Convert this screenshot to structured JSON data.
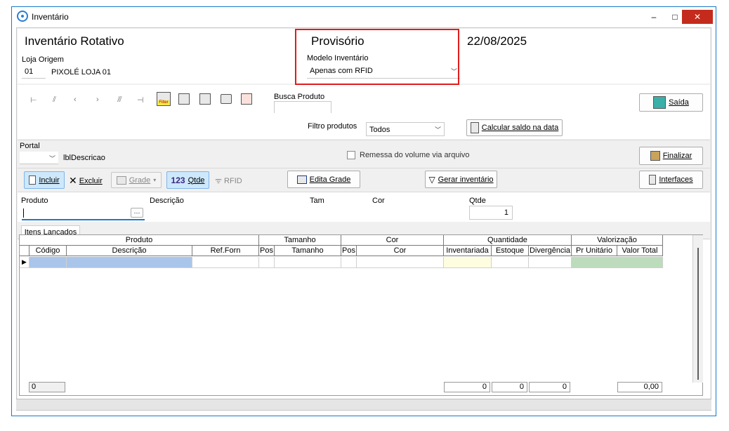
{
  "window": {
    "title": "Inventário",
    "minimize": "–",
    "maximize": "□",
    "close": "✕"
  },
  "header": {
    "title": "Inventário Rotativo",
    "status": "Provisório",
    "date": "22/08/2025",
    "loja_origem_label": "Loja Origem",
    "loja_code": "01",
    "loja_name": "PIXOLÉ LOJA 01",
    "modelo_label": "Modelo Inventário",
    "modelo_value": "Apenas com RFID"
  },
  "toolbar": {
    "busca_label": "Busca Produto",
    "busca_value": "",
    "saida_label": "Saída",
    "filter_icon_text": "Filter"
  },
  "filters": {
    "filtro_label": "Filtro produtos",
    "filtro_value": "Todos",
    "calcular_label": "Calcular saldo na data"
  },
  "portal": {
    "label": "Portal",
    "value": "",
    "descricao": "lblDescricao",
    "remessa_label": "Remessa do volume via arquivo",
    "finalizar_label": "Finalizar"
  },
  "actions": {
    "incluir": "Incluir",
    "excluir": "Excluir",
    "grade": "Grade",
    "qtde": "Qtde",
    "qtde_prefix": "123",
    "rfid": "RFID",
    "edita_grade": "Edita Grade",
    "gerar": "Gerar inventário",
    "interfaces": "Interfaces"
  },
  "entry": {
    "produto_label": "Produto",
    "descricao_label": "Descrição",
    "tam_label": "Tam",
    "cor_label": "Cor",
    "qtde_label": "Qtde",
    "qtde_value": "1",
    "ellipsis": "···"
  },
  "tabs": [
    {
      "label": "Itens Lançados"
    }
  ],
  "grid": {
    "groups": [
      "Produto",
      "Tamanho",
      "Cor",
      "Quantidade",
      "Valorização"
    ],
    "columns": [
      "Código",
      "Descrição",
      "Ref.Forn",
      "Pos",
      "Tamanho",
      "Pos",
      "Cor",
      "Inventariada",
      "Estoque",
      "Divergência",
      "Pr Unitário",
      "Valor Total"
    ],
    "footer": {
      "count": "0",
      "inventariada": "0",
      "estoque": "0",
      "divergencia": "0",
      "valor_total": "0,00"
    }
  },
  "colors": {
    "accent_border": "#1979ca",
    "highlight": "#e11c1c",
    "selected_cell": "#a9c6ea",
    "inventariada_cell": "#fffde0",
    "valor_cell": "#bcdcbc"
  }
}
